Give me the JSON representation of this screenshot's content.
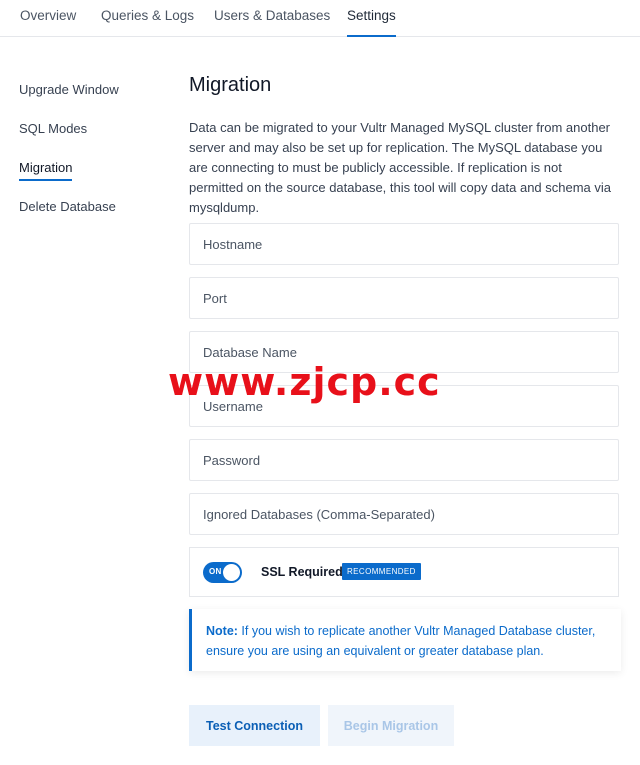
{
  "tabs": {
    "overview": "Overview",
    "queries_logs": "Queries & Logs",
    "users_databases": "Users & Databases",
    "settings": "Settings"
  },
  "sidebar": {
    "upgrade_window": "Upgrade Window",
    "sql_modes": "SQL Modes",
    "migration": "Migration",
    "delete_database": "Delete Database"
  },
  "main": {
    "title": "Migration",
    "description": "Data can be migrated to your Vultr Managed MySQL cluster from another server and may also be set up for replication. The MySQL database you are connecting to must be publicly accessible. If replication is not permitted on the source database, this tool will copy data and schema via mysqldump.",
    "fields": {
      "hostname": "Hostname",
      "port": "Port",
      "database_name": "Database Name",
      "username": "Username",
      "password": "Password",
      "ignored_databases": "Ignored Databases (Comma-Separated)"
    },
    "ssl": {
      "toggle_text": "ON",
      "label": "SSL Required",
      "badge": "RECOMMENDED"
    },
    "note": {
      "prefix": "Note:",
      "text": " If you wish to replicate another Vultr Managed Database cluster, ensure you are using an equivalent or greater database plan."
    },
    "buttons": {
      "test": "Test Connection",
      "begin": "Begin Migration"
    }
  },
  "watermark": "www.zjcp.cc",
  "colors": {
    "accent": "#0b6bcb",
    "watermark": "#e8101a"
  }
}
